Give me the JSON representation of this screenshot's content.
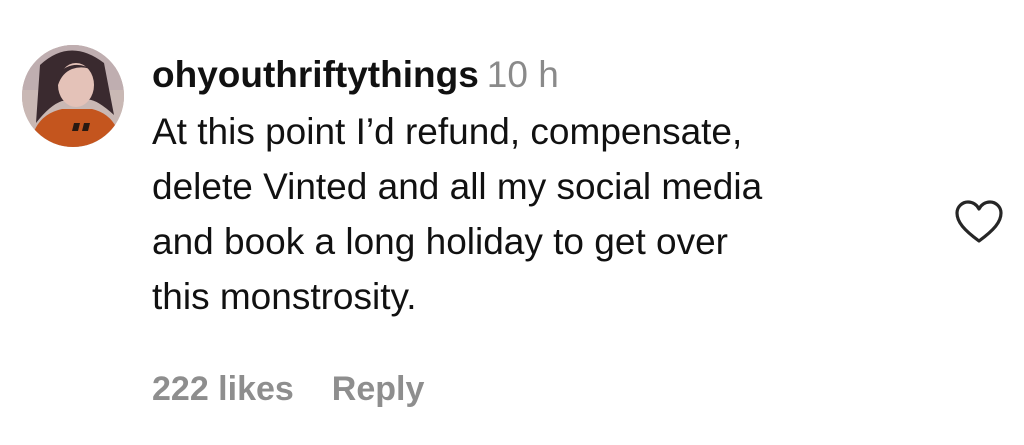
{
  "comment": {
    "username": "ohyouthriftythings",
    "time": "10 h",
    "text_lines": [
      "At this point I’d refund, compensate,",
      "delete Vinted and all my social media",
      "and book a long holiday to get over",
      "this monstrosity."
    ],
    "likes": "222 likes",
    "reply_label": "Reply",
    "like_icon": "heart-outline-icon"
  },
  "colors": {
    "text": "#111111",
    "muted": "#8e8e8e",
    "background": "#ffffff"
  }
}
